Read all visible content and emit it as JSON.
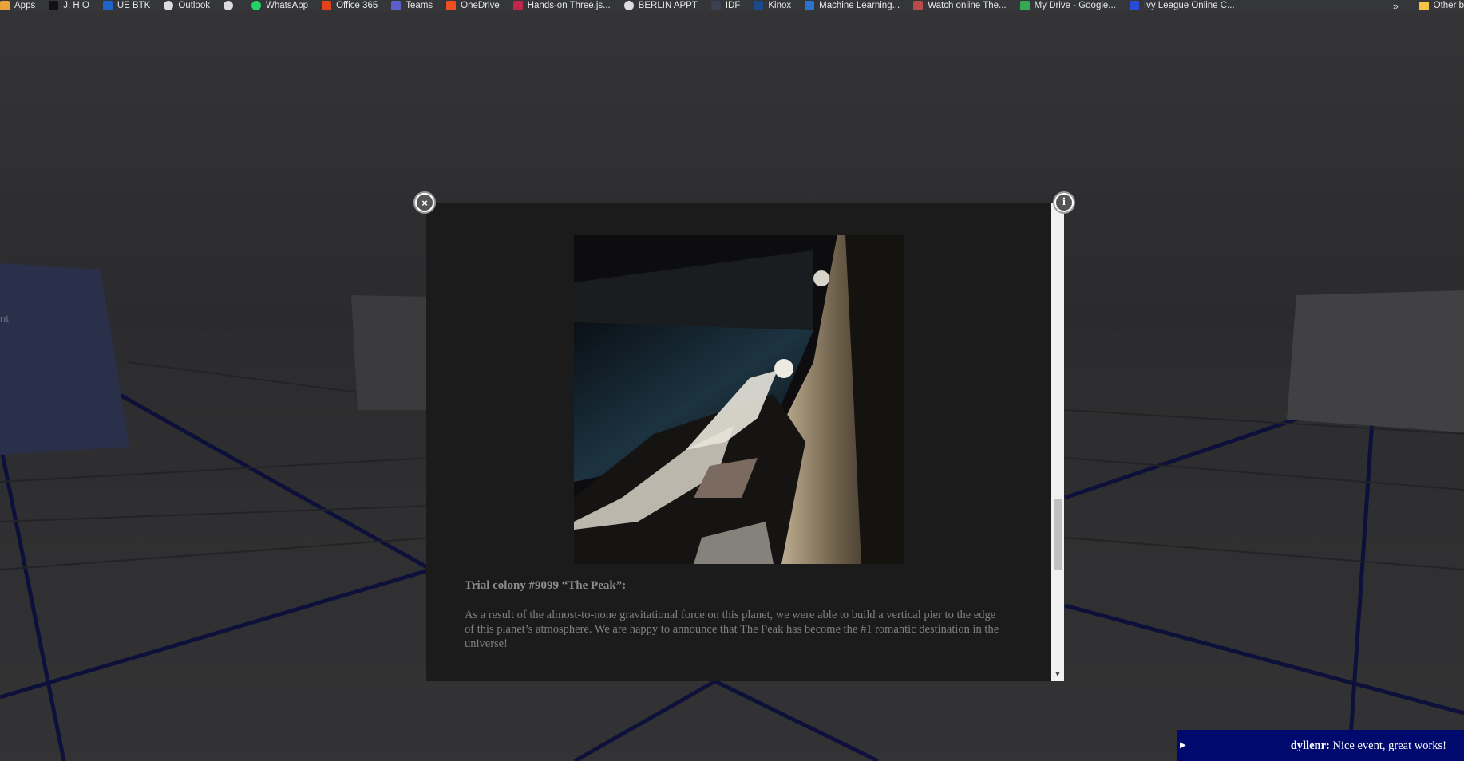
{
  "bookmarks": {
    "items": [
      {
        "label": "Apps",
        "icon": "apps-grid-icon",
        "color": "#e8a33a"
      },
      {
        "label": "J. H O",
        "icon": "tiktok-icon",
        "color": "#111111"
      },
      {
        "label": "UE BTK",
        "icon": "bookmark-blue-icon",
        "color": "#1e64c8"
      },
      {
        "label": "Outlook",
        "icon": "globe-icon",
        "color": "#dddddd"
      },
      {
        "label": "",
        "icon": "globe-icon",
        "color": "#dddddd"
      },
      {
        "label": "WhatsApp",
        "icon": "whatsapp-icon",
        "color": "#25d366"
      },
      {
        "label": "Office 365",
        "icon": "office-icon",
        "color": "#e3411b"
      },
      {
        "label": "Teams",
        "icon": "teams-icon",
        "color": "#5b5fc7"
      },
      {
        "label": "OneDrive",
        "icon": "microsoft-icon",
        "color": "#f25022"
      },
      {
        "label": "Hands-on Three.js...",
        "icon": "udemy-icon",
        "color": "#c0264a"
      },
      {
        "label": "BERLIN APPT",
        "icon": "globe-icon",
        "color": "#dddddd"
      },
      {
        "label": "IDF",
        "icon": "idf-icon",
        "color": "#3b4150"
      },
      {
        "label": "Kinox",
        "icon": "kinox-icon",
        "color": "#1b4a8a"
      },
      {
        "label": "Machine Learning...",
        "icon": "coursera-icon",
        "color": "#2a73cc"
      },
      {
        "label": "Watch online The...",
        "icon": "star-icon",
        "color": "#b84a4a"
      },
      {
        "label": "My Drive - Google...",
        "icon": "google-drive-icon",
        "color": "#34a853"
      },
      {
        "label": "Ivy League Online C...",
        "icon": "edx-icon",
        "color": "#2a4bd8"
      }
    ],
    "more": "»",
    "other": "Other b"
  },
  "scene": {
    "left_panel_text": "nt"
  },
  "modal": {
    "title": "Trial colony #9099 “The Peak”:",
    "body": "As a result of the almost-to-none gravitational force on this planet, we were able to build a vertical pier to the edge of this planet’s atmosphere. We are happy to announce that The Peak has become the #1 romantic destination in the universe!",
    "close_icon": "×",
    "info_icon": "i",
    "scroll_down": "▼"
  },
  "chat": {
    "toggle": "▶",
    "user": "dyllenr:",
    "message": " Nice event, great works!"
  }
}
